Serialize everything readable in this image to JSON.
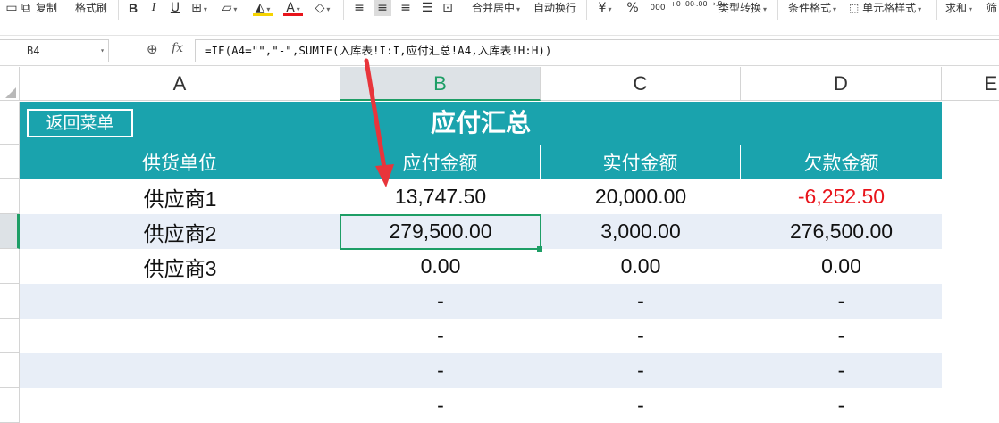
{
  "toolbar": {
    "copy": "复制",
    "format_painter": "格式刷",
    "bold": "B",
    "italic": "I",
    "underline": "U",
    "font_color": "A",
    "merge_center": "合并居中",
    "wrap_text": "自动换行",
    "currency": "¥",
    "percent": "%",
    "thousands": "000",
    "dec_inc": "+0 .00",
    "dec_dec": "-.00 →.0",
    "type_convert": "类型转换",
    "cond_format": "条件格式",
    "cell_style": "单元格样式",
    "sum": "求和",
    "filter": "筛"
  },
  "formula_bar": {
    "name_box": "B4",
    "fx": "fx",
    "formula": "=IF(A4=\"\",\"-\",SUMIF(入库表!I:I,应付汇总!A4,入库表!H:H))"
  },
  "columns": [
    "A",
    "B",
    "C",
    "D",
    "E"
  ],
  "selected_column": "B",
  "sheet": {
    "back_button": "返回菜单",
    "title": "应付汇总",
    "headers": [
      "供货单位",
      "应付金额",
      "实付金额",
      "欠款金额"
    ],
    "rows": [
      [
        "供应商1",
        "13,747.50",
        "20,000.00",
        "-6,252.50"
      ],
      [
        "供应商2",
        "279,500.00",
        "3,000.00",
        "276,500.00"
      ],
      [
        "供应商3",
        "0.00",
        "0.00",
        "0.00"
      ],
      [
        "",
        "-",
        "-",
        "-"
      ],
      [
        "",
        "-",
        "-",
        "-"
      ],
      [
        "",
        "-",
        "-",
        "-"
      ],
      [
        "",
        "-",
        "-",
        "-"
      ]
    ]
  },
  "colors": {
    "header_bg": "#1aa3ad",
    "stripe_bg": "#e8eef7",
    "negative": "#e8141b",
    "selection": "#1e9e66",
    "annotation_arrow": "#e8353b"
  }
}
